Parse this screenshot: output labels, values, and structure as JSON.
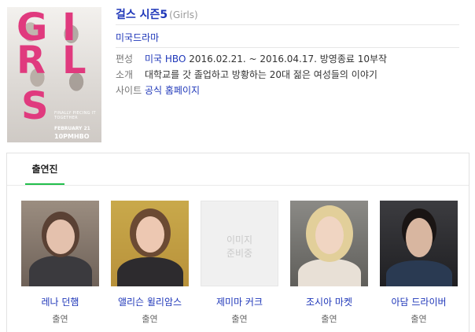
{
  "poster": {
    "letters": [
      "G",
      "I",
      "R",
      "L",
      "S"
    ],
    "tagline": "FINALLY PIECING IT TOGETHER",
    "date": "FEBRUARY 21",
    "time": "10PM",
    "network": "HBO",
    "accent_color": "#e03a7e"
  },
  "show": {
    "title": "걸스 시즌5",
    "original_title": "(Girls)",
    "genre": "미국드라마"
  },
  "info": {
    "schedule_label": "편성",
    "network_link": "미국 HBO",
    "schedule_value": "2016.02.21. ~ 2016.04.17. 방영종료 10부작",
    "synopsis_label": "소개",
    "synopsis_value": "대학교를 갓 졸업하고 방황하는 20대 젊은 여성들의 이야기",
    "site_label": "사이트",
    "site_link": "공식 홈페이지"
  },
  "cast": {
    "tab_label": "출연진",
    "actors": [
      {
        "name": "레나 던햄",
        "role": "출연"
      },
      {
        "name": "앨리슨 윌리암스",
        "role": "출연"
      },
      {
        "name": "제미마 커크",
        "role": "출연",
        "no_photo_line1": "이미지",
        "no_photo_line2": "준비중"
      },
      {
        "name": "조시아 마켓",
        "role": "출연"
      },
      {
        "name": "아담 드라이버",
        "role": "출연"
      }
    ]
  },
  "colors": {
    "link": "#1f37b9",
    "tab_underline": "#22bf4c"
  }
}
